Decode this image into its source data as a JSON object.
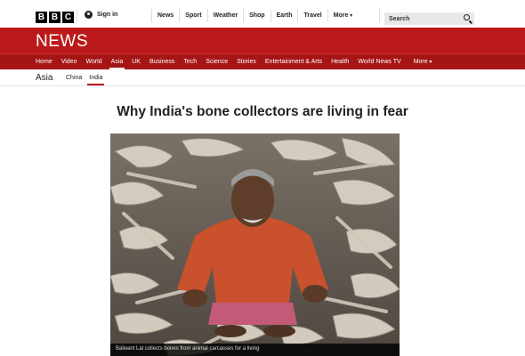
{
  "logo": {
    "letters": [
      "B",
      "B",
      "C"
    ]
  },
  "account": {
    "signin_label": "Sign in",
    "icon": "user-icon"
  },
  "top_nav": {
    "items": [
      "News",
      "Sport",
      "Weather",
      "Shop",
      "Earth",
      "Travel"
    ],
    "more_label": "More"
  },
  "search": {
    "placeholder": "Search",
    "icon": "search-icon"
  },
  "brand": {
    "title": "NEWS",
    "color": "#bb1919"
  },
  "section_nav": {
    "items": [
      "Home",
      "Video",
      "World",
      "Asia",
      "UK",
      "Business",
      "Tech",
      "Science",
      "Stories",
      "Entertainment & Arts",
      "Health",
      "World News TV"
    ],
    "active": "Asia",
    "more_label": "More"
  },
  "sub_nav": {
    "section": "Asia",
    "items": [
      "China",
      "India"
    ],
    "active": "India"
  },
  "article": {
    "headline": "Why India's bone collectors are living in fear",
    "image_caption": "Balwant Lal collects bones from animal carcasses for a living"
  }
}
